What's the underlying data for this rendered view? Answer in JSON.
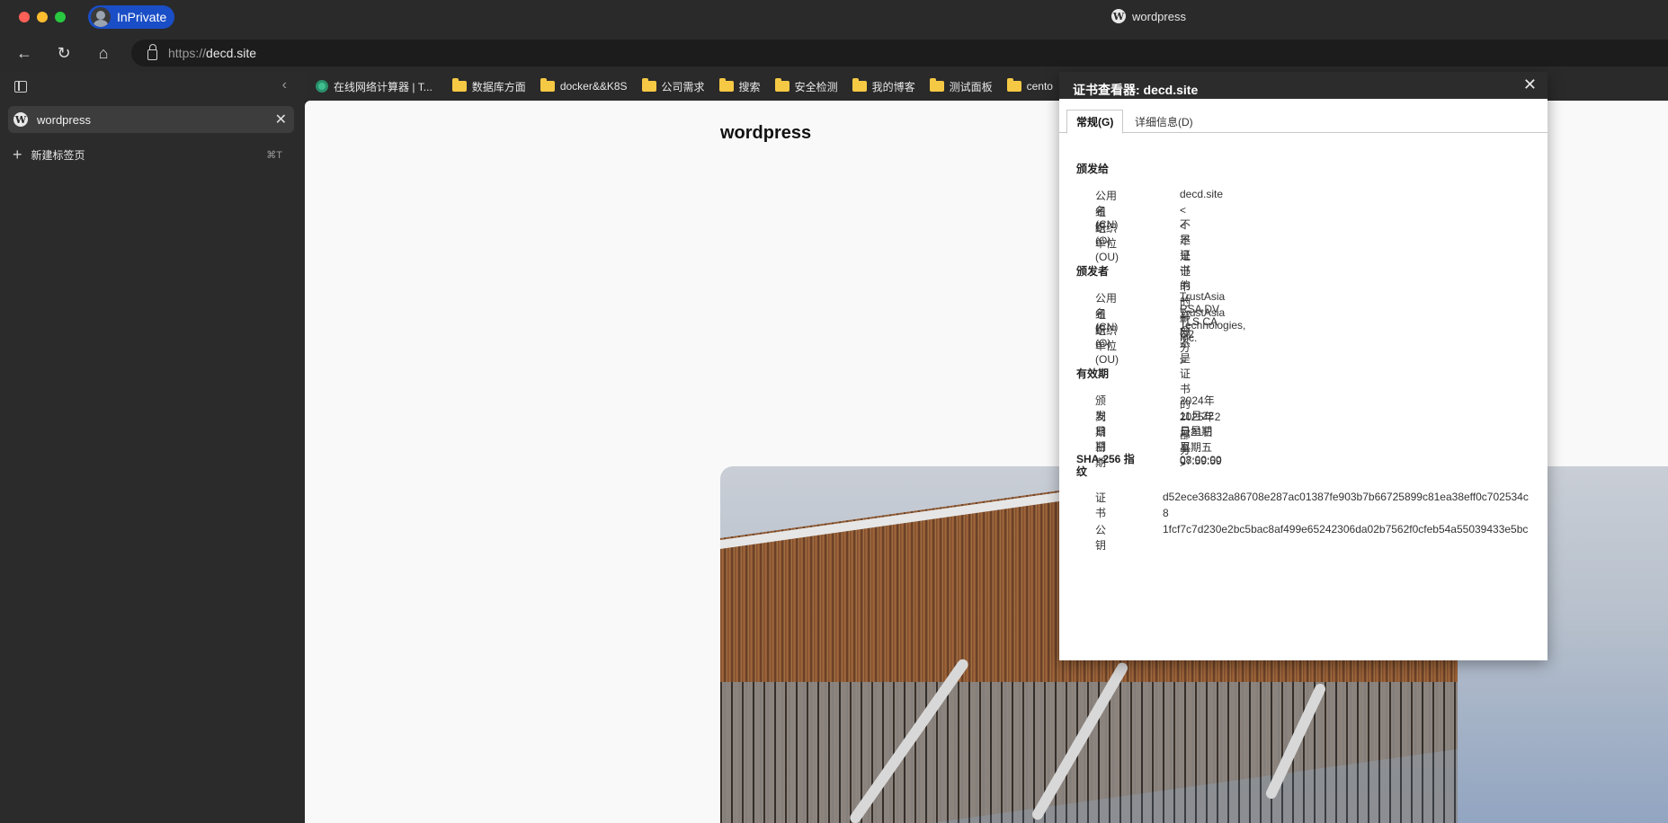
{
  "window": {
    "title": "wordpress",
    "inprivate_label": "InPrivate"
  },
  "toolbar": {
    "url_protocol": "https://",
    "url_host": "decd.site"
  },
  "sidebar": {
    "tabs": [
      {
        "label": "wordpress"
      }
    ],
    "new_tab_label": "新建标签页",
    "new_tab_shortcut": "⌘T"
  },
  "bookmarks": [
    {
      "label": "在线网络计算器 | T...",
      "icon": "gear-icon"
    },
    {
      "label": "数据库方面",
      "icon": "folder-icon"
    },
    {
      "label": "docker&&K8S",
      "icon": "folder-icon"
    },
    {
      "label": "公司需求",
      "icon": "folder-icon"
    },
    {
      "label": "搜索",
      "icon": "folder-icon"
    },
    {
      "label": "安全检测",
      "icon": "folder-icon"
    },
    {
      "label": "我的博客",
      "icon": "folder-icon"
    },
    {
      "label": "测试面板",
      "icon": "folder-icon"
    },
    {
      "label": "cento",
      "icon": "folder-icon"
    }
  ],
  "page": {
    "site_title": "wordpress"
  },
  "cert_viewer": {
    "title": "证书查看器: decd.site",
    "tabs": [
      "常规(G)",
      "详细信息(D)"
    ],
    "issued_to": {
      "heading": "颁发给",
      "rows": [
        {
          "k": "公用名(CN)",
          "v": "decd.site"
        },
        {
          "k": "组织(O)",
          "v": "<不是证书的一部分>"
        },
        {
          "k": "组织单位(OU)",
          "v": "<不是证书的一部分>"
        }
      ]
    },
    "issued_by": {
      "heading": "颁发者",
      "rows": [
        {
          "k": "公用名(CN)",
          "v": "TrustAsia RSA DV TLS CA G2"
        },
        {
          "k": "组织(O)",
          "v": "TrustAsia Technologies, Inc."
        },
        {
          "k": "组织单位(OU)",
          "v": "<不是证书的一部分>"
        }
      ]
    },
    "validity": {
      "heading": "有效期",
      "rows": [
        {
          "k": "颁发日期",
          "v": "2024年11月22日星期五 08:00:00"
        },
        {
          "k": "到期日期",
          "v": "2025年2月21日星期五 07:59:59"
        }
      ]
    },
    "fingerprints": {
      "heading_line1": "SHA-256 指",
      "heading_line2": "纹",
      "cert_label": "证书",
      "cert_value": "d52ece36832a86708e287ac01387fe903b7b66725899c81ea38eff0c702534c8",
      "key_label": "公钥",
      "key_value": "1fcf7c7d230e2bc5bac8af499e65242306da02b7562f0cfeb54a55039433e5bc"
    }
  }
}
